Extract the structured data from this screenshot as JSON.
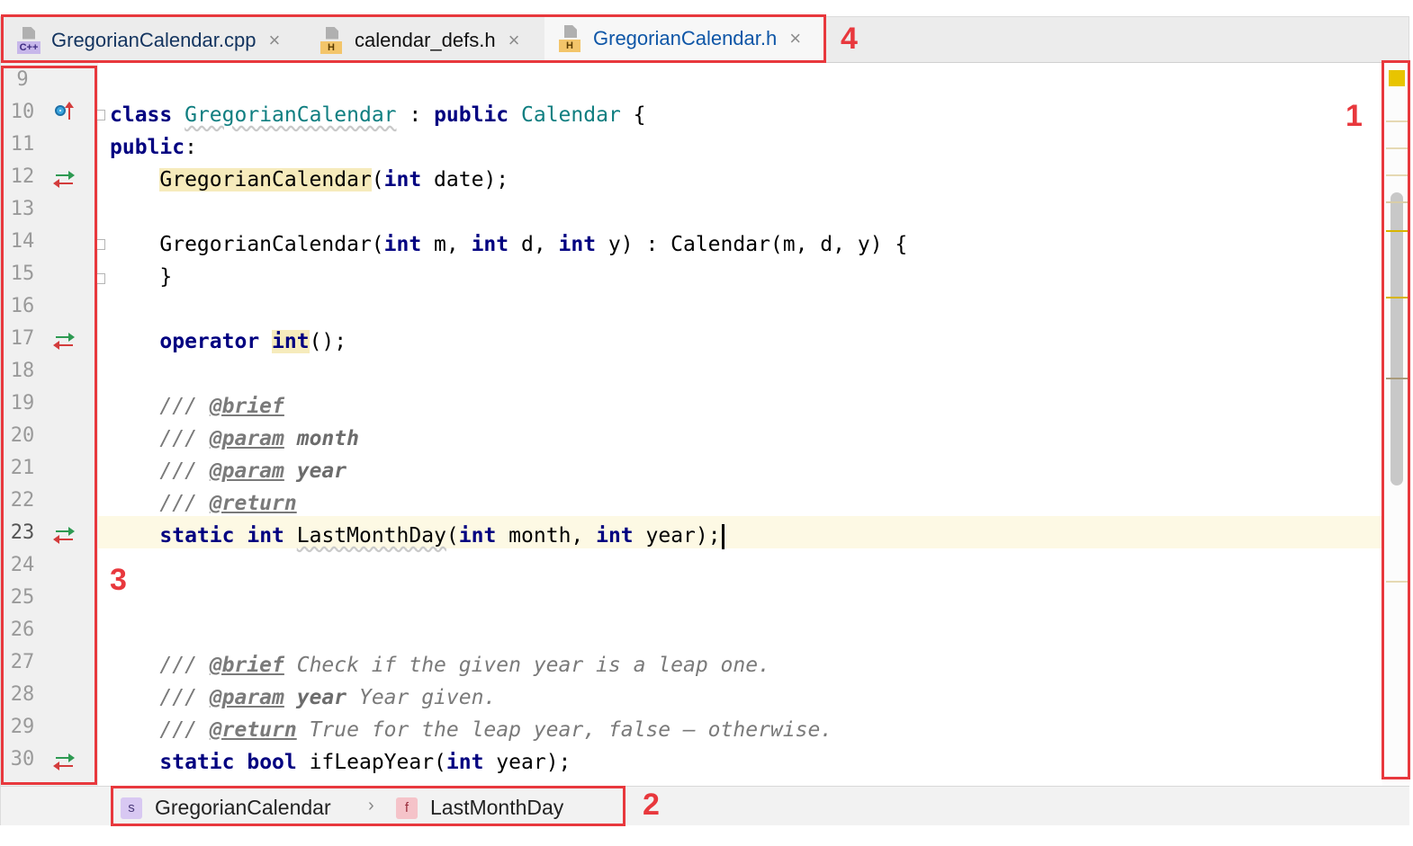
{
  "tabs": [
    {
      "name": "GregorianCalendar.cpp",
      "badge": "C++",
      "kind": "cpp",
      "active": false
    },
    {
      "name": "calendar_defs.h",
      "badge": "H",
      "kind": "h",
      "active": false
    },
    {
      "name": "GregorianCalendar.h",
      "badge": "H",
      "kind": "h",
      "active": true
    }
  ],
  "tab_close_glyph": "×",
  "line_numbers": [
    "9",
    "10",
    "11",
    "12",
    "13",
    "14",
    "15",
    "16",
    "17",
    "18",
    "19",
    "20",
    "21",
    "22",
    "23",
    "24",
    "25",
    "26",
    "27",
    "28",
    "29",
    "30"
  ],
  "current_line": "23",
  "gutter_icons": [
    {
      "line": "10",
      "icon": "overrides-up-icon"
    },
    {
      "line": "12",
      "icon": "navigate-declaration-icon"
    },
    {
      "line": "17",
      "icon": "navigate-declaration-icon"
    },
    {
      "line": "23",
      "icon": "navigate-declaration-icon"
    },
    {
      "line": "30",
      "icon": "navigate-declaration-icon"
    }
  ],
  "code": {
    "l10": {
      "kw1": "class",
      "cls": "GregorianCalendar",
      "colon": " : ",
      "kw2": "public",
      "base": "Calendar",
      "brace": " {"
    },
    "l11": {
      "kw": "public",
      "rest": ":"
    },
    "l12": {
      "fn": "GregorianCalendar",
      "p1": "(",
      "kw": "int",
      "p2": " date);"
    },
    "l14": {
      "a": "GregorianCalendar(",
      "k1": "int",
      "b": " m, ",
      "k2": "int",
      "c": " d, ",
      "k3": "int",
      "d": " y) : Calendar(m, d, y) {"
    },
    "l15": {
      "text": "}"
    },
    "l17": {
      "kw": "operator",
      "kw2": "int",
      "rest": "();"
    },
    "l19": {
      "slashes": "/// ",
      "tag": "@brief"
    },
    "l20": {
      "slashes": "/// ",
      "tag": "@param",
      "pname": "month"
    },
    "l21": {
      "slashes": "/// ",
      "tag": "@param",
      "pname": "year"
    },
    "l22": {
      "slashes": "/// ",
      "tag": "@return"
    },
    "l23": {
      "k1": "static",
      "k2": "int",
      "fn": "LastMonthDay",
      "p1": "(",
      "k3": "int",
      "p2": " month, ",
      "k4": "int",
      "p3": " year);"
    },
    "l27": {
      "slashes": "/// ",
      "tag": "@brief",
      "text": " Check if the given year is a leap one."
    },
    "l28": {
      "slashes": "/// ",
      "tag": "@param",
      "pname": "year",
      "text": " Year given."
    },
    "l29": {
      "slashes": "/// ",
      "tag": "@return",
      "text": " True for the leap year, false – otherwise."
    },
    "l30": {
      "k1": "static",
      "k2": "bool",
      "fn": " ifLeapYear(",
      "k3": "int",
      "p": " year);"
    }
  },
  "breadcrumb": [
    {
      "badge": "s",
      "label": "GregorianCalendar"
    },
    {
      "badge": "f",
      "label": "LastMonthDay"
    }
  ],
  "breadcrumb_separator": "›",
  "annotations": [
    "1",
    "2",
    "3",
    "4"
  ],
  "colors": {
    "annotation": "#e8383d",
    "keyword": "#000080",
    "type": "#0f7e80",
    "active_tab_underline": "#4083c9",
    "warning_marker": "#e8c400"
  }
}
